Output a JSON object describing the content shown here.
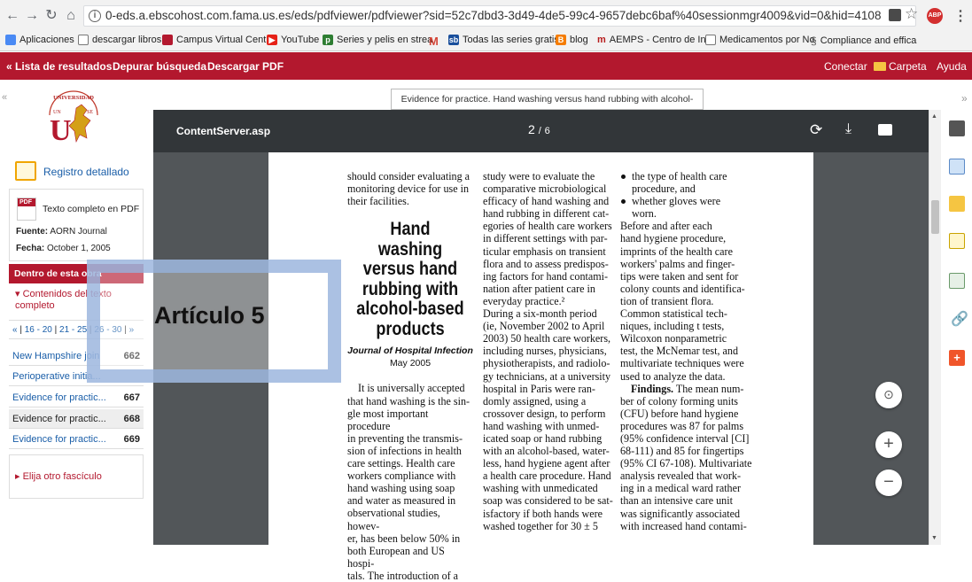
{
  "browser": {
    "url": "0-eds.a.ebscohost.com.fama.us.es/eds/pdfviewer/pdfviewer?sid=52c7dbd3-3d49-4de5-99c4-9657debc6baf%40sessionmgr4009&vid=0&hid=4108",
    "bookmarks": [
      {
        "label": "Aplicaciones",
        "icon": "apps-grid-icon"
      },
      {
        "label": "descargar libros",
        "icon": "page-icon"
      },
      {
        "label": "Campus Virtual Centr",
        "icon": "campus-icon"
      },
      {
        "label": "YouTube",
        "icon": "youtube-icon"
      },
      {
        "label": "Series y pelis en strea",
        "icon": "series-icon"
      },
      {
        "label": "",
        "icon": "gmail-icon"
      },
      {
        "label": "Todas las series gratis",
        "icon": "sb-icon"
      },
      {
        "label": "blog",
        "icon": "blogger-icon"
      },
      {
        "label": "AEMPS - Centro de In",
        "icon": "aemps-icon"
      },
      {
        "label": "Medicamentos por No",
        "icon": "page-icon"
      },
      {
        "label": "Compliance and effica",
        "icon": "compliance-icon"
      }
    ],
    "extension_badge": "ABP"
  },
  "toolbar": {
    "results": "« Lista de resultados",
    "refine": "Depurar búsqueda",
    "download": "Descargar PDF",
    "connect": "Conectar",
    "folder": "Carpeta",
    "help": "Ayuda"
  },
  "sidebar": {
    "detailed": "Registro detallado",
    "fulltext": "Texto completo en PDF",
    "source_label": "Fuente:",
    "source": "AORN Journal",
    "date_label": "Fecha:",
    "date": "October 1, 2005",
    "within": "Dentro de esta obra",
    "contents": "Contenidos del texto completo",
    "pages": [
      "«",
      "16 - 20",
      "21 - 25",
      "26 - 30",
      "»"
    ],
    "articles": [
      {
        "title": "New Hampshire join",
        "page": "662",
        "active": false
      },
      {
        "title": "Perioperative initia...",
        "page": "",
        "active": false
      },
      {
        "title": "Evidence for practic...",
        "page": "667",
        "active": false
      },
      {
        "title": "Evidence for practic...",
        "page": "668",
        "active": true
      },
      {
        "title": "Evidence for practic...",
        "page": "669",
        "active": false
      }
    ],
    "other_issue": "Elija otro fascículo",
    "pdf_badge": "PDF"
  },
  "viewer": {
    "tab_title": "Evidence for practice. Hand washing versus hand rubbing with alcohol-based ...",
    "file": "ContentServer.asp",
    "page_current": "2",
    "page_sep": "/",
    "page_total": "6",
    "zoom_in": "+",
    "zoom_out": "−"
  },
  "document": {
    "col1_top": [
      "should consider evaluating a",
      "monitoring device for use in",
      "their facilities."
    ],
    "title_lines": [
      "Hand washing",
      "versus hand",
      "rubbing with",
      "alcohol-based",
      "products"
    ],
    "journal": "Journal of Hospital Infection",
    "journal_date": "May 2005",
    "col1_body": [
      "It is universally accepted",
      "that hand washing is the sin-",
      "gle most important procedure",
      "in preventing the transmis-",
      "sion of infections in health",
      "care settings. Health care",
      "workers compliance with",
      "hand washing using soap",
      "and water as measured in",
      "observational studies, howev-",
      "er, has been below 50% in",
      "both European and US hospi-",
      "tals. The introduction of a"
    ],
    "col2": [
      "study were to evaluate the",
      "comparative microbiological",
      "efficacy of hand washing and",
      "hand rubbing in different cat-",
      "egories of health care workers",
      "in different settings with par-",
      "ticular emphasis on transient",
      "flora and to assess predispos-",
      "ing factors for hand contami-",
      "nation after patient care in",
      "everyday practice.²",
      "   During a six-month period",
      "(ie, November 2002 to April",
      "2003) 50 health care workers,",
      "including nurses, physicians,",
      "physiotherapists, and radiolo-",
      "gy technicians, at a university",
      "hospital in Paris were ran-",
      "domly assigned, using a",
      "crossover design, to perform",
      "hand washing with unmed-",
      "icated soap or hand rubbing",
      "with an alcohol-based, water-",
      "less, hand hygiene agent after",
      "a health care procedure. Hand",
      "washing with unmedicated",
      "soap was considered to be sat-",
      "isfactory if both hands were",
      "washed together for 30 ± 5"
    ],
    "col3_bullets": [
      [
        "the type of health care",
        "procedure, and"
      ],
      [
        "whether gloves were",
        "worn."
      ]
    ],
    "col3": [
      "   Before and after each",
      "hand hygiene procedure,",
      "imprints of the health care",
      "workers' palms and finger-",
      "tips were taken and sent for",
      "colony counts and identifica-",
      "tion of transient flora.",
      "Common statistical tech-",
      "niques, including t tests,",
      "Wilcoxon nonparametric",
      "test, the McNemar test, and",
      "multivariate techniques were",
      "used to analyze the data."
    ],
    "findings_label": "Findings.",
    "col3_findings": [
      " The mean num-",
      "ber of colony forming units",
      "(CFU) before hand hygiene",
      "procedures was 87 for palms",
      "(95% confidence interval [CI]",
      "68-111) and 85 for fingertips",
      "(95% CI 67-108). Multivariate",
      "analysis revealed that work-",
      "ing in a medical ward rather",
      "than an intensive care unit",
      "was significantly associated",
      "with increased hand contami-"
    ]
  },
  "overlay": {
    "label": "Artículo 5"
  },
  "colors": {
    "brand_red": "#b3182e",
    "link_blue": "#1a5ea8",
    "viewer_dark": "#323639",
    "viewer_bg": "#525659",
    "overlay_blue": "#96b2dc"
  }
}
